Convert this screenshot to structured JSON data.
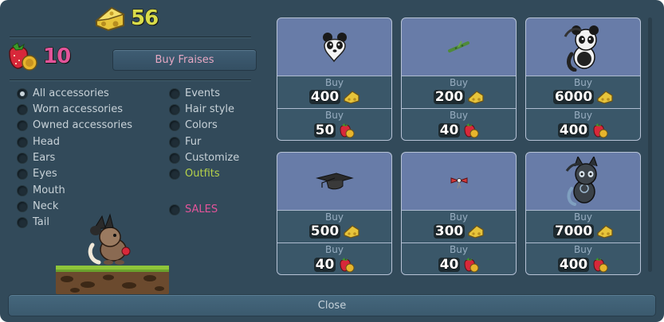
{
  "currency": {
    "cheese": "56",
    "fraises": "10"
  },
  "buy_fraises_label": "Buy Fraises",
  "filters": {
    "left": [
      {
        "label": "All accessories",
        "selected": true
      },
      {
        "label": "Worn accessories",
        "selected": false
      },
      {
        "label": "Owned accessories",
        "selected": false
      },
      {
        "label": "Head",
        "selected": false
      },
      {
        "label": "Ears",
        "selected": false
      },
      {
        "label": "Eyes",
        "selected": false
      },
      {
        "label": "Mouth",
        "selected": false
      },
      {
        "label": "Neck",
        "selected": false
      },
      {
        "label": "Tail",
        "selected": false
      }
    ],
    "right": [
      {
        "label": "Events",
        "selected": false
      },
      {
        "label": "Hair style",
        "selected": false
      },
      {
        "label": "Colors",
        "selected": false
      },
      {
        "label": "Fur",
        "selected": false
      },
      {
        "label": "Customize",
        "selected": false
      },
      {
        "label": "Outfits",
        "selected": false
      }
    ],
    "sales": {
      "label": "SALES",
      "selected": false
    }
  },
  "items": [
    {
      "icon": "panda-head-icon",
      "buy_label_1": "Buy",
      "cheese_price": "400",
      "buy_label_2": "Buy",
      "fraise_price": "50"
    },
    {
      "icon": "bamboo-icon",
      "buy_label_1": "Buy",
      "cheese_price": "200",
      "buy_label_2": "Buy",
      "fraise_price": "40"
    },
    {
      "icon": "panda-outfit-icon",
      "buy_label_1": "Buy",
      "cheese_price": "6000",
      "buy_label_2": "Buy",
      "fraise_price": "400"
    },
    {
      "icon": "graduation-cap-icon",
      "buy_label_1": "Buy",
      "cheese_price": "500",
      "buy_label_2": "Buy",
      "fraise_price": "40"
    },
    {
      "icon": "ribbon-icon",
      "buy_label_1": "Buy",
      "cheese_price": "300",
      "buy_label_2": "Buy",
      "fraise_price": "40"
    },
    {
      "icon": "dark-outfit-icon",
      "buy_label_1": "Buy",
      "cheese_price": "7000",
      "buy_label_2": "Buy",
      "fraise_price": "400"
    }
  ],
  "close_label": "Close",
  "colors": {
    "cheese_count": "#d9dc4a",
    "fraise_count": "#e3549a",
    "outfits": "#b6d24a",
    "sales": "#e3549a"
  }
}
